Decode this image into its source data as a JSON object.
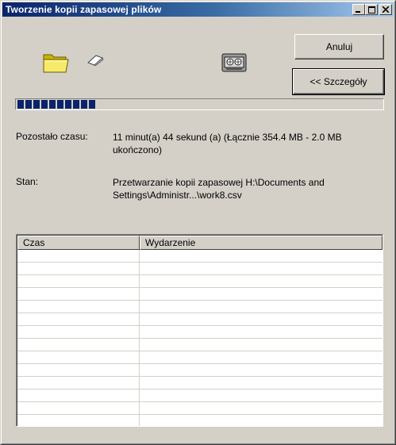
{
  "window": {
    "title": "Tworzenie kopii zapasowej plików",
    "controls": [
      "minimize-icon",
      "maximize-icon",
      "close-icon"
    ]
  },
  "icons": [
    "folder-icon",
    "paper-icon",
    "tape-drive-icon"
  ],
  "buttons": {
    "cancel_label": "Anuluj",
    "details_label": "<< Szczegóły"
  },
  "progress": {
    "fraction": 0.22,
    "filled_blocks": 10,
    "color": "#0a246a"
  },
  "status": {
    "time_label": "Pozostało czasu:",
    "time_value": "11 minut(a) 44 sekund (a) (Łącznie 354.4 MB - 2.0 MB ukończono)",
    "state_label": "Stan:",
    "state_value": "Przetwarzanie kopii zapasowej H:\\Documents and Settings\\Administr...\\work8.csv"
  },
  "log": {
    "columns": [
      "Czas",
      "Wydarzenie"
    ],
    "rows": []
  }
}
